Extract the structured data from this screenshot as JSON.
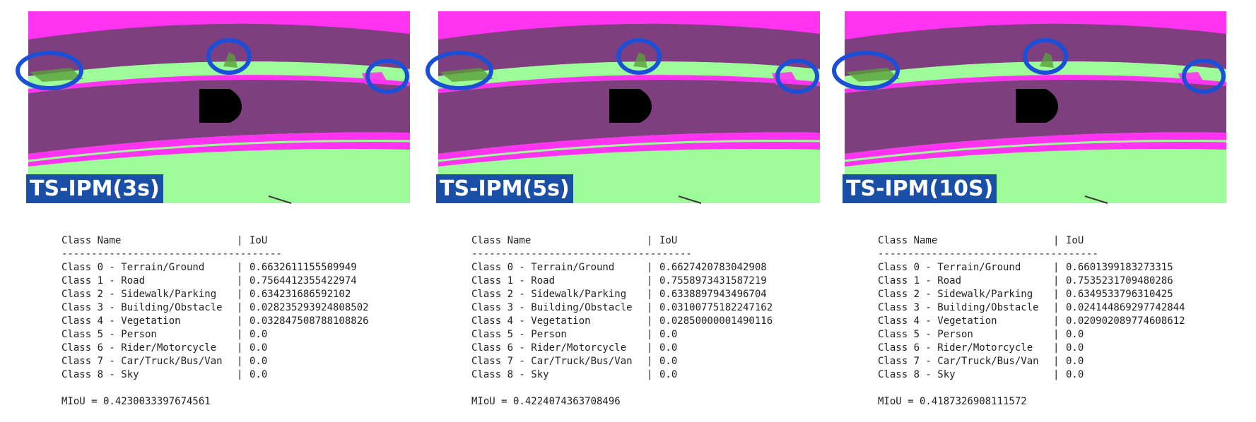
{
  "colors": {
    "terrain": "#9efb9a",
    "road": "#7d3f7d",
    "sidewalk": "#ff33f0",
    "vegetation": "#5aa03a",
    "vehicle_mask": "#000000",
    "label_bg": "#1a4fa8",
    "highlight_circle": "#1c4fd8"
  },
  "table_header": {
    "class_name": "Class Name",
    "separator": "|",
    "iou": "IoU",
    "rule": "-------------------------------------"
  },
  "class_names": [
    "Class 0 - Terrain/Ground",
    "Class 1 - Road",
    "Class 2 - Sidewalk/Parking",
    "Class 3 - Building/Obstacle",
    "Class 4 - Vegetation",
    "Class 5 - Person",
    "Class 6 - Rider/Motorcycle",
    "Class 7 - Car/Truck/Bus/Van",
    "Class 8 - Sky"
  ],
  "panels": [
    {
      "label": "TS-IPM(3s)",
      "ious": [
        "0.6632611155509949",
        "0.7564412355422974",
        "0.634231686592102",
        "0.028235293924808502",
        "0.032847508788108826",
        "0.0",
        "0.0",
        "0.0",
        "0.0"
      ],
      "miou_text": "MIoU = 0.4230033397674561"
    },
    {
      "label": "TS-IPM(5s)",
      "ious": [
        "0.6627420783042908",
        "0.7558973431587219",
        "0.6338897943496704",
        "0.03100775182247162",
        "0.02850000001490116",
        "0.0",
        "0.0",
        "0.0",
        "0.0"
      ],
      "miou_text": "MIoU = 0.4224074363708496"
    },
    {
      "label": "TS-IPM(10S)",
      "ious": [
        "0.6601399183273315",
        "0.7535231709480286",
        "0.6349533796310425",
        "0.024144869297742844",
        "0.020902089774608612",
        "0.0",
        "0.0",
        "0.0",
        "0.0"
      ],
      "miou_text": "MIoU = 0.4187326908111572"
    }
  ]
}
